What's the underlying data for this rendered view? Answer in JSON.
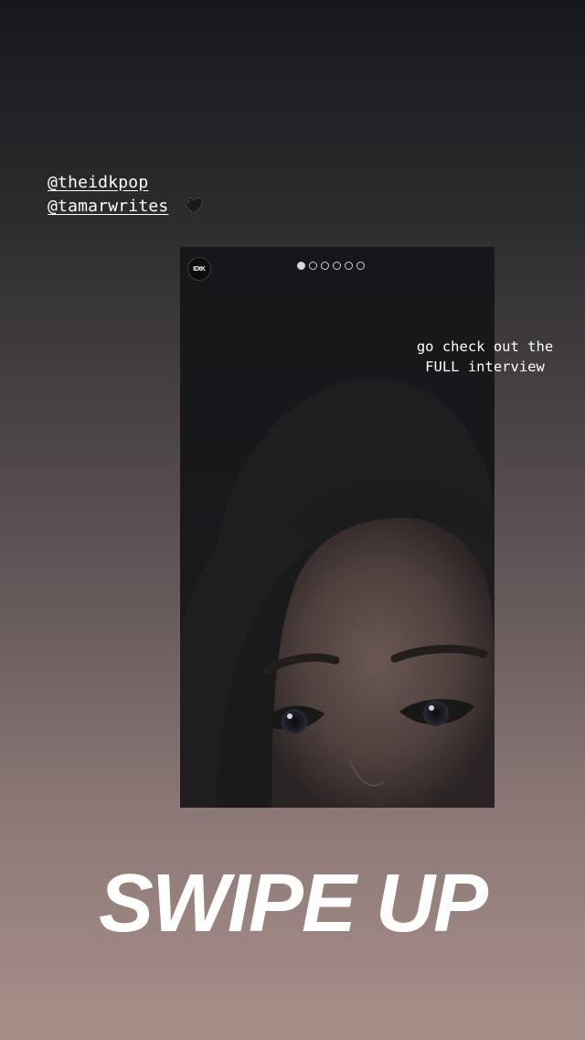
{
  "mentions": {
    "line1": "@theidkpop",
    "line2": "@tamarwrites",
    "heart_icon": "black-heart-icon"
  },
  "card": {
    "logo_text": "IDtK",
    "carousel": {
      "total": 6,
      "active_index": 0
    }
  },
  "callout": {
    "line1": "go check out the",
    "line2": "FULL interview"
  },
  "cta": {
    "label": "SWIPE UP"
  },
  "colors": {
    "text": "#ffffff",
    "background_top": "#16181b",
    "background_bottom": "#a88f8a"
  }
}
